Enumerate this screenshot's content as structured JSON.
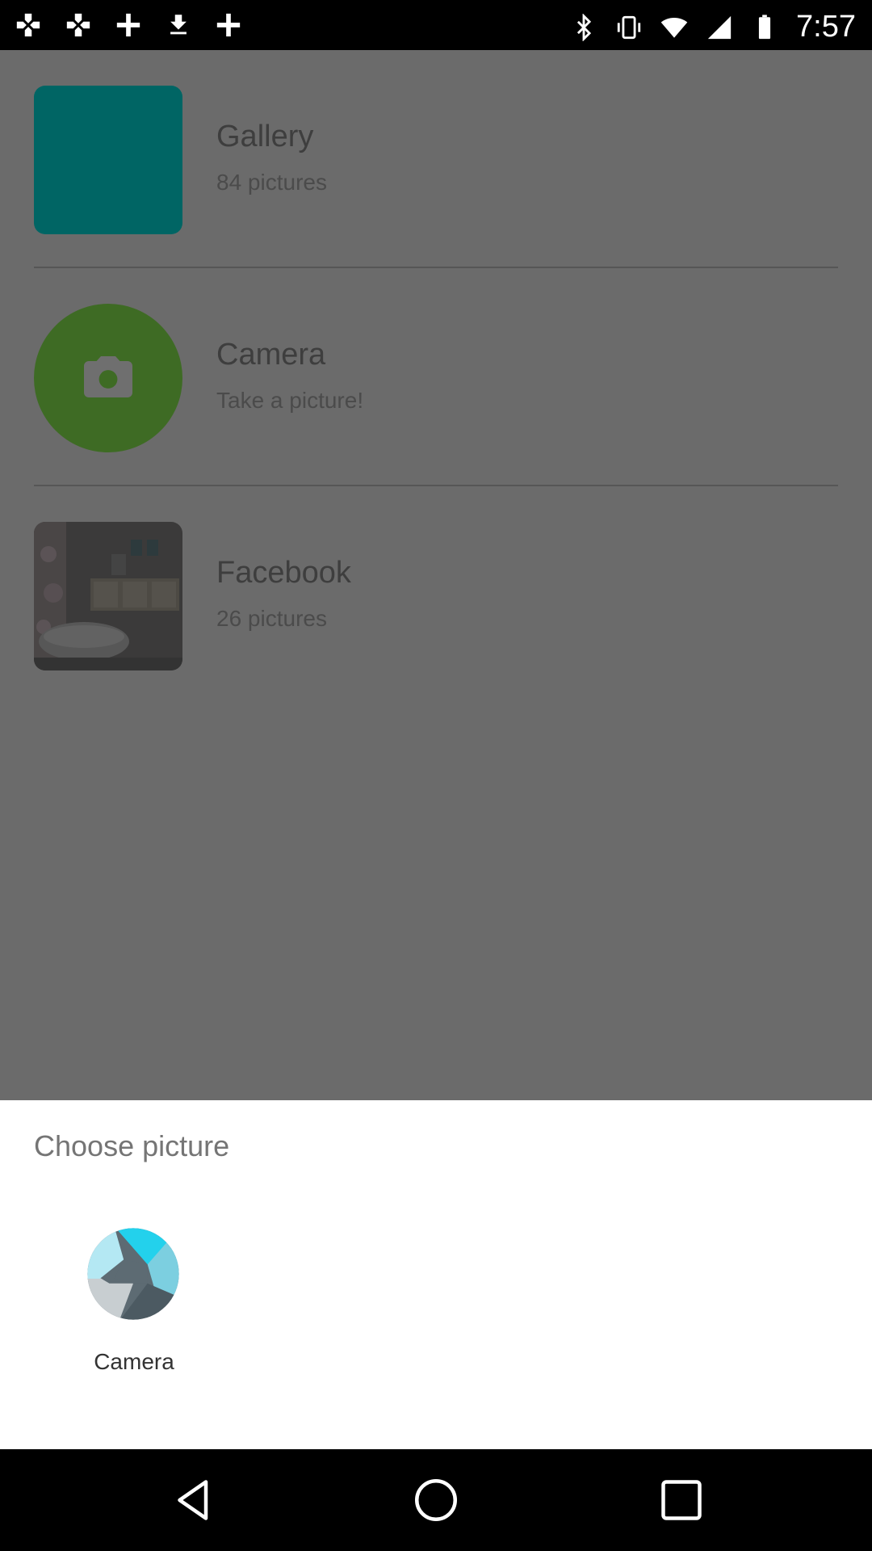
{
  "status_bar": {
    "time": "7:57",
    "left_icons": [
      "gamepad-icon",
      "gamepad-icon",
      "cross-icon",
      "download-icon",
      "cross-icon"
    ],
    "right_icons": [
      "bluetooth-icon",
      "vibrate-icon",
      "wifi-icon",
      "signal-icon",
      "battery-icon"
    ]
  },
  "list": {
    "items": [
      {
        "title": "Gallery",
        "subtitle": "84 pictures",
        "thumb_color": "#006564"
      },
      {
        "title": "Camera",
        "subtitle": "Take a picture!",
        "thumb_color": "#3e6b24"
      },
      {
        "title": "Facebook",
        "subtitle": "26 pictures",
        "thumb_color": "#3a3a3a"
      }
    ]
  },
  "sheet": {
    "title": "Choose picture",
    "options": [
      {
        "label": "Camera",
        "icon": "camera-shutter-icon"
      }
    ]
  },
  "nav": {
    "buttons": [
      "back-icon",
      "home-icon",
      "recents-icon"
    ]
  },
  "colors": {
    "scrim": "#6b6b6b",
    "sheet_bg": "#ffffff",
    "bar_bg": "#000000"
  }
}
